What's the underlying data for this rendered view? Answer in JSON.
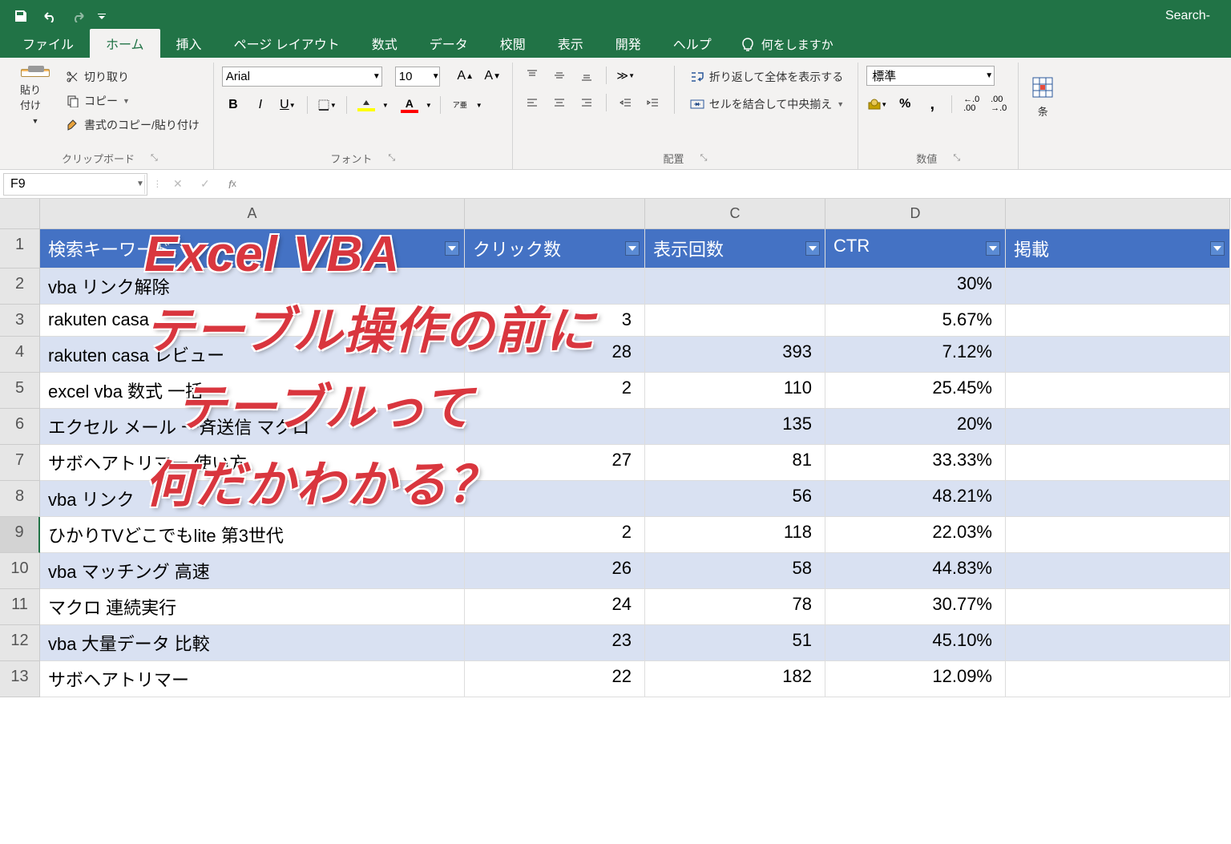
{
  "titlebar": {
    "title": "Search-"
  },
  "tabs": {
    "file": "ファイル",
    "home": "ホーム",
    "insert": "挿入",
    "pagelayout": "ページ レイアウト",
    "formulas": "数式",
    "data": "データ",
    "review": "校閲",
    "view": "表示",
    "developer": "開発",
    "help": "ヘルプ",
    "tellme": "何をしますか"
  },
  "ribbon": {
    "clipboard": {
      "label": "クリップボード",
      "paste": "貼り付け",
      "cut": "切り取り",
      "copy": "コピー",
      "formatpainter": "書式のコピー/貼り付け"
    },
    "font": {
      "label": "フォント",
      "name": "Arial",
      "size": "10",
      "ruby": "ア亜"
    },
    "alignment": {
      "label": "配置",
      "wrap": "折り返して全体を表示する",
      "merge": "セルを結合して中央揃え"
    },
    "number": {
      "label": "数値",
      "format": "標準"
    },
    "cond": "条"
  },
  "formula": {
    "namebox": "F9"
  },
  "columns": [
    "",
    "A",
    "",
    "C",
    "D",
    ""
  ],
  "headers": [
    "検索キーワード",
    "クリック数",
    "表示回数",
    "CTR",
    "掲載"
  ],
  "rows": [
    {
      "n": 1
    },
    {
      "n": 2,
      "a": "vba リンク解除",
      "b": "",
      "c": "",
      "d": "30%"
    },
    {
      "n": 3,
      "a": "rakuten casa",
      "b": "3",
      "c": "",
      "d": "5.67%"
    },
    {
      "n": 4,
      "a": "rakuten casa レビュー",
      "b": "28",
      "c": "393",
      "d": "7.12%"
    },
    {
      "n": 5,
      "a": "excel vba 数式 一括",
      "b": "2",
      "c": "110",
      "d": "25.45%"
    },
    {
      "n": 6,
      "a": "エクセル メール 一斉送信 マクロ",
      "b": "",
      "c": "135",
      "d": "20%"
    },
    {
      "n": 7,
      "a": "サボヘアトリマー 使い方",
      "b": "27",
      "c": "81",
      "d": "33.33%"
    },
    {
      "n": 8,
      "a": "vba リンク",
      "b": "",
      "c": "56",
      "d": "48.21%"
    },
    {
      "n": 9,
      "a": "ひかりTVどこでもlite 第3世代",
      "b": "2",
      "c": "118",
      "d": "22.03%"
    },
    {
      "n": 10,
      "a": "vba マッチング 高速",
      "b": "26",
      "c": "58",
      "d": "44.83%"
    },
    {
      "n": 11,
      "a": "マクロ 連続実行",
      "b": "24",
      "c": "78",
      "d": "30.77%"
    },
    {
      "n": 12,
      "a": "vba 大量データ 比較",
      "b": "23",
      "c": "51",
      "d": "45.10%"
    },
    {
      "n": 13,
      "a": "サボヘアトリマー",
      "b": "22",
      "c": "182",
      "d": "12.09%"
    }
  ],
  "overlay": {
    "l1": "Excel VBA",
    "l2": "テーブル操作の前に",
    "l3": "テーブルって",
    "l4": "何だかわかる？"
  }
}
